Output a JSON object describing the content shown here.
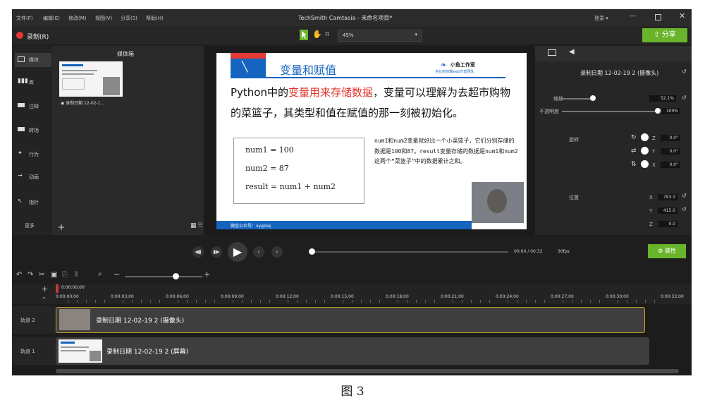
{
  "window": {
    "menu": [
      "文件(F)",
      "编辑(E)",
      "修改(M)",
      "视图(V)",
      "分享(S)",
      "帮助(H)"
    ],
    "title": "TechSmith Camtasia - 未命名项目*",
    "login": "登录 ▾"
  },
  "toolbar": {
    "record_label": "录制(R)",
    "zoom": "45%",
    "share_label": "分享"
  },
  "nav": {
    "items": [
      "媒体",
      "库",
      "注释",
      "转场",
      "行为",
      "动画",
      "指针"
    ],
    "more": "更多"
  },
  "media_bin": {
    "title": "媒体箱",
    "clip_name": "录制日期 12-02-1..."
  },
  "slide": {
    "heading": "变量和赋值",
    "logo_title": "小鱼工作室",
    "logo_sub": "专业的前端web开发团队",
    "para_a": "Python中的",
    "para_highlight": "变量用来存储数据",
    "para_b": "，变量可以理解为去超市购物的菜篮子，其类型和值在赋值的那一刻被初始化。",
    "code": [
      "num1 = 100",
      "num2 = 87",
      "result = num1 + num2"
    ],
    "note": "num1和num2变量就好比一个小菜篮子，它们分别存储的数据是100和87。result变量存储的数据是num1和num2这两个“菜篮子”中的数据累计之和。",
    "footer": "微信公众号：xygzsq"
  },
  "props": {
    "clip_title": "录制日期 12-02-19 2 (摄像头)",
    "scale_label": "缩放",
    "scale_value": "52.1%",
    "opacity_label": "不透明度",
    "opacity_value": "100%",
    "rotation_label": "旋转",
    "rot_z_label": "Z",
    "rot_z": "0.0°",
    "rot_y_label": "Y",
    "rot_y": "0.0°",
    "rot_x_label": "X",
    "rot_x": "0.0°",
    "position_label": "位置",
    "pos_x_label": "X",
    "pos_x": "793.3",
    "pos_y_label": "Y",
    "pos_y": "415.0",
    "pos_z_label": "Z",
    "pos_z": "0.0"
  },
  "playback": {
    "time": "00:00 / 00:32",
    "fps": "30fps",
    "properties_label": "属性"
  },
  "timeline": {
    "playhead_time": "0:00:00;00",
    "ticks": [
      "0:00:00;00",
      "0:00:03;00",
      "0:00:06;00",
      "0:00:09;00",
      "0:00:12;00",
      "0:00:15;00",
      "0:00:18;00",
      "0:00:21;00",
      "0:00:24;00",
      "0:00:27;00",
      "0:00:30;00",
      "0:00:33;00"
    ],
    "tracks": [
      {
        "name": "轨道 2",
        "clip": "录制日期 12-02-19 2 (摄像头)"
      },
      {
        "name": "轨道 1",
        "clip": "录制日期 12-02-19 2 (屏幕)"
      }
    ]
  },
  "caption": "图 3",
  "colors": {
    "accent_green": "#6ab42c",
    "record_red": "#e53935",
    "slide_blue": "#1565c0",
    "highlight_red": "#e0322b"
  }
}
